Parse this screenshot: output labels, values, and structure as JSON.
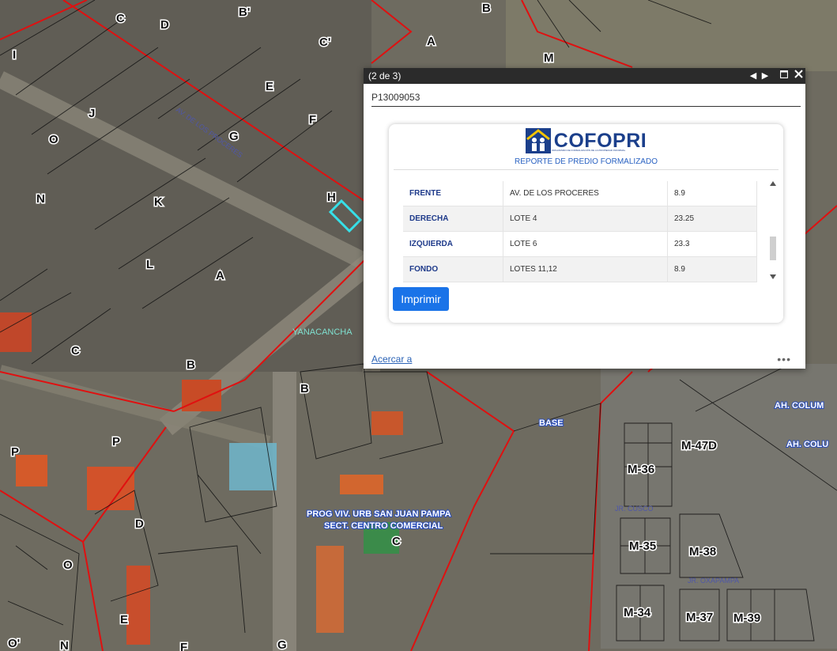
{
  "popup": {
    "counter": "(2 de 3)",
    "feature_id": "P13009053",
    "logo_text": "COFOPRI",
    "logo_subtitle": "ORGANISMO DE FORMALIZACIÓN DE LA PROPIEDAD INFORMAL",
    "report_title": "REPORTE DE PREDIO FORMALIZADO",
    "rows": [
      {
        "side": "FRENTE",
        "neighbor": "AV. DE LOS PROCERES",
        "length": "8.9"
      },
      {
        "side": "DERECHA",
        "neighbor": "LOTE 4",
        "length": "23.25"
      },
      {
        "side": "IZQUIERDA",
        "neighbor": "LOTE 6",
        "length": "23.3"
      },
      {
        "side": "FONDO",
        "neighbor": "LOTES 11,12",
        "length": "8.9"
      }
    ],
    "print_label": "Imprimir",
    "zoom_label": "Acercar a",
    "more_label": "•••",
    "icons": [
      "prev-icon",
      "next-icon",
      "maximize-icon",
      "close-icon"
    ]
  },
  "map": {
    "block_labels": [
      "B",
      "C",
      "D",
      "B'",
      "C'",
      "A",
      "M",
      "I",
      "J",
      "E",
      "F",
      "G",
      "O",
      "N",
      "K",
      "H",
      "L",
      "A",
      "C",
      "B",
      "B",
      "P",
      "P",
      "D",
      "C",
      "O",
      "O'",
      "N",
      "E",
      "F",
      "G",
      "M-36",
      "M-35",
      "M-38",
      "M-34",
      "M-37",
      "M-39",
      "M-47D"
    ],
    "place_labels": [
      {
        "text": "YANACANCHA",
        "color": "#7fe0d0"
      },
      {
        "text": "BASE",
        "color": "#dfe9ff"
      },
      {
        "text": "PROG VIV. URB SAN JUAN PAMPA",
        "color": "#dfe9ff"
      },
      {
        "text": "SECT. CENTRO COMERCIAL",
        "color": "#dfe9ff"
      },
      {
        "text": "AH. COLUM",
        "color": "#dfe9ff"
      },
      {
        "text": "AH. COLU",
        "color": "#dfe9ff"
      },
      {
        "text": "JR. CUSCO",
        "color": "#4f57a8"
      },
      {
        "text": "JR. OXAPAMPA",
        "color": "#4f57a8"
      },
      {
        "text": "AV. DE LOS PROCERES",
        "color": "#4f57a8"
      }
    ],
    "boundary_color": "#e01010",
    "highlight_color": "#36e0e8"
  }
}
